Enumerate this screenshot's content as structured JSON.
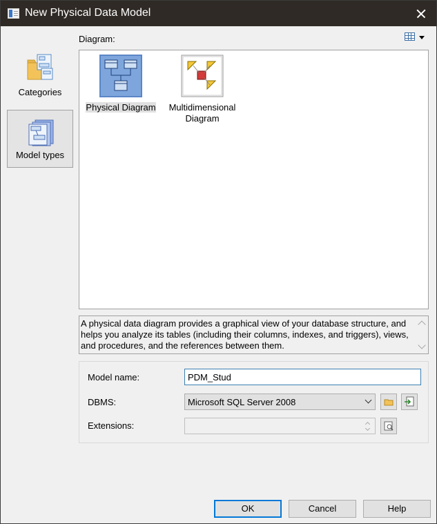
{
  "window": {
    "title": "New Physical Data Model"
  },
  "categories": [
    {
      "label": "Categories",
      "icon": "folder-diagram-icon",
      "selected": false
    },
    {
      "label": "Model types",
      "icon": "model-types-icon",
      "selected": true
    }
  ],
  "diagram_section": {
    "label": "Diagram:",
    "view_icon": "list-view-icon"
  },
  "diagrams": [
    {
      "label": "Physical Diagram",
      "icon": "physical-diagram-icon",
      "selected": true
    },
    {
      "label": "Multidimensional Diagram",
      "label_line1": "Multidimensional",
      "label_line2": "Diagram",
      "icon": "multidimensional-diagram-icon",
      "selected": false
    }
  ],
  "description": "A physical data diagram provides a graphical view of your database structure, and helps you analyze its tables (including their columns, indexes, and triggers), views, and procedures, and the references between them.",
  "form": {
    "model_name_label": "Model name:",
    "model_name_value": "PDM_Stud",
    "dbms_label": "DBMS:",
    "dbms_value": "Microsoft SQL Server 2008",
    "extensions_label": "Extensions:",
    "extensions_value": ""
  },
  "buttons": {
    "ok": "OK",
    "cancel": "Cancel",
    "help": "Help"
  }
}
